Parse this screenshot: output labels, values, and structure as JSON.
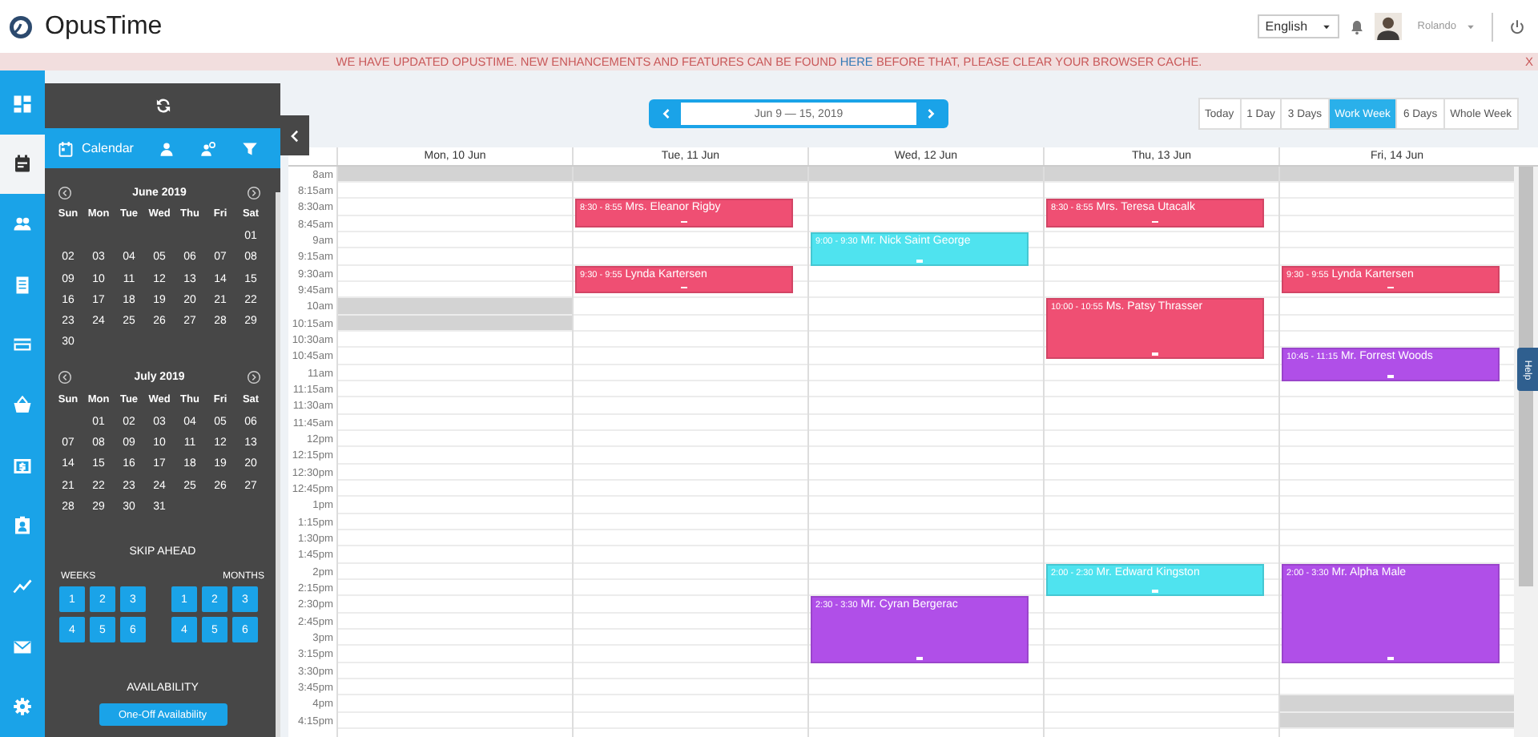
{
  "header": {
    "logo": "OpusTime",
    "language": "English",
    "user": "Rolando"
  },
  "banner": {
    "before": "WE HAVE UPDATED OPUSTIME. NEW ENHANCEMENTS AND FEATURES CAN BE FOUND",
    "link": "HERE",
    "after": "BEFORE THAT, PLEASE CLEAR YOUR BROWSER CACHE.",
    "close": "X"
  },
  "rail": [
    {
      "selected": false
    },
    {
      "selected": true
    },
    {
      "selected": false
    },
    {
      "selected": false
    },
    {
      "selected": false
    },
    {
      "selected": false
    },
    {
      "selected": false
    },
    {
      "selected": false
    },
    {
      "selected": false
    },
    {
      "selected": false
    },
    {
      "selected": false
    }
  ],
  "panel": {
    "tab": "Calendar",
    "months": [
      {
        "title": "June 2019",
        "weekdays": [
          "Sun",
          "Mon",
          "Tue",
          "Wed",
          "Thu",
          "Fri",
          "Sat"
        ],
        "weeks": [
          {
            "sat": "01"
          },
          {
            "sun": "02",
            "mon": "03",
            "tue": "04",
            "wed": "05",
            "thu": "06",
            "fri": "07",
            "sat": "08"
          },
          {
            "sun": "09",
            "mon": "10",
            "tue": "11",
            "wed": "12",
            "thu": "13",
            "fri": "14",
            "sat": "15"
          },
          {
            "sun": "16",
            "mon": "17",
            "tue": "18",
            "wed": "19",
            "thu": "20",
            "fri": "21",
            "sat": "22"
          },
          {
            "sun": "23",
            "mon": "24",
            "tue": "25",
            "wed": "26",
            "thu": "27",
            "fri": "28",
            "sat": "29"
          },
          {
            "sun": "30"
          }
        ]
      },
      {
        "title": "July 2019",
        "weekdays": [
          "Sun",
          "Mon",
          "Tue",
          "Wed",
          "Thu",
          "Fri",
          "Sat"
        ],
        "weeks": [
          {
            "mon": "01",
            "tue": "02",
            "wed": "03",
            "thu": "04",
            "fri": "05",
            "sat": "06"
          },
          {
            "sun": "07",
            "mon": "08",
            "tue": "09",
            "wed": "10",
            "thu": "11",
            "fri": "12",
            "sat": "13"
          },
          {
            "sun": "14",
            "mon": "15",
            "tue": "16",
            "wed": "17",
            "thu": "18",
            "fri": "19",
            "sat": "20"
          },
          {
            "sun": "21",
            "mon": "22",
            "tue": "23",
            "wed": "24",
            "thu": "25",
            "fri": "26",
            "sat": "27"
          },
          {
            "sun": "28",
            "mon": "29",
            "tue": "30",
            "wed": "31"
          }
        ]
      }
    ],
    "skip_ahead": {
      "title": "SKIP AHEAD",
      "weeks_label": "WEEKS",
      "months_label": "MONTHS",
      "weeks": [
        "1",
        "2",
        "3",
        "4",
        "5",
        "6"
      ],
      "months": [
        "1",
        "2",
        "3",
        "4",
        "5",
        "6"
      ]
    },
    "availability": {
      "title": "AVAILABILITY",
      "button": "One-Off Availability"
    }
  },
  "toolbar": {
    "range": "Jun 9 — 15, 2019",
    "views": [
      {
        "label": "Today",
        "selected": false
      },
      {
        "label": "1 Day",
        "selected": false
      },
      {
        "label": "3 Days",
        "selected": false
      },
      {
        "label": "Work Week",
        "selected": true
      },
      {
        "label": "6 Days",
        "selected": false
      },
      {
        "label": "Whole Week",
        "selected": false
      }
    ]
  },
  "calendar": {
    "rows": [
      {
        "time": "8am",
        "unavailable": [
          true,
          true,
          true,
          true,
          true
        ]
      },
      {
        "time": "8:15am",
        "unavailable": [
          false,
          false,
          false,
          false,
          false
        ]
      },
      {
        "time": "8:30am",
        "unavailable": [
          false,
          false,
          false,
          false,
          false
        ]
      },
      {
        "time": "8:45am",
        "unavailable": [
          false,
          false,
          false,
          false,
          false
        ]
      },
      {
        "time": "9am",
        "unavailable": [
          false,
          false,
          false,
          false,
          false
        ]
      },
      {
        "time": "9:15am",
        "unavailable": [
          false,
          false,
          false,
          false,
          false
        ]
      },
      {
        "time": "9:30am",
        "unavailable": [
          false,
          false,
          false,
          false,
          false
        ]
      },
      {
        "time": "9:45am",
        "unavailable": [
          false,
          false,
          false,
          false,
          false
        ]
      },
      {
        "time": "10am",
        "unavailable": [
          true,
          false,
          false,
          false,
          false
        ]
      },
      {
        "time": "10:15am",
        "unavailable": [
          true,
          false,
          false,
          false,
          false
        ]
      },
      {
        "time": "10:30am",
        "unavailable": [
          false,
          false,
          false,
          false,
          false
        ]
      },
      {
        "time": "10:45am",
        "unavailable": [
          false,
          false,
          false,
          false,
          false
        ]
      },
      {
        "time": "11am",
        "unavailable": [
          false,
          false,
          false,
          false,
          false
        ]
      },
      {
        "time": "11:15am",
        "unavailable": [
          false,
          false,
          false,
          false,
          false
        ]
      },
      {
        "time": "11:30am",
        "unavailable": [
          false,
          false,
          false,
          false,
          false
        ]
      },
      {
        "time": "11:45am",
        "unavailable": [
          false,
          false,
          false,
          false,
          false
        ]
      },
      {
        "time": "12pm",
        "unavailable": [
          false,
          false,
          false,
          false,
          false
        ]
      },
      {
        "time": "12:15pm",
        "unavailable": [
          false,
          false,
          false,
          false,
          false
        ]
      },
      {
        "time": "12:30pm",
        "unavailable": [
          false,
          false,
          false,
          false,
          false
        ]
      },
      {
        "time": "12:45pm",
        "unavailable": [
          false,
          false,
          false,
          false,
          false
        ]
      },
      {
        "time": "1pm",
        "unavailable": [
          false,
          false,
          false,
          false,
          false
        ]
      },
      {
        "time": "1:15pm",
        "unavailable": [
          false,
          false,
          false,
          false,
          false
        ]
      },
      {
        "time": "1:30pm",
        "unavailable": [
          false,
          false,
          false,
          false,
          false
        ]
      },
      {
        "time": "1:45pm",
        "unavailable": [
          false,
          false,
          false,
          false,
          false
        ]
      },
      {
        "time": "2pm",
        "unavailable": [
          false,
          false,
          false,
          false,
          false
        ]
      },
      {
        "time": "2:15pm",
        "unavailable": [
          false,
          false,
          false,
          false,
          false
        ]
      },
      {
        "time": "2:30pm",
        "unavailable": [
          false,
          false,
          false,
          false,
          false
        ]
      },
      {
        "time": "2:45pm",
        "unavailable": [
          false,
          false,
          false,
          false,
          false
        ]
      },
      {
        "time": "3pm",
        "unavailable": [
          false,
          false,
          false,
          false,
          false
        ]
      },
      {
        "time": "3:15pm",
        "unavailable": [
          false,
          false,
          false,
          false,
          false
        ]
      },
      {
        "time": "3:30pm",
        "unavailable": [
          false,
          false,
          false,
          false,
          false
        ]
      },
      {
        "time": "3:45pm",
        "unavailable": [
          false,
          false,
          false,
          false,
          false
        ]
      },
      {
        "time": "4pm",
        "unavailable": [
          false,
          false,
          false,
          false,
          true
        ]
      },
      {
        "time": "4:15pm",
        "unavailable": [
          false,
          false,
          false,
          false,
          true
        ]
      }
    ],
    "days": [
      {
        "label": "Mon, 10 Jun"
      },
      {
        "label": "Tue, 11 Jun",
        "events": [
          {
            "time": "8:30 - 8:55",
            "name": "Mrs. Eleanor Rigby",
            "color": "#ef4f73"
          },
          {
            "time": "9:30 - 9:55",
            "name": "Lynda Kartersen",
            "color": "#ef4f73"
          }
        ]
      },
      {
        "label": "Wed, 12 Jun",
        "events": [
          {
            "time": "9:00 - 9:30",
            "name": "Mr. Nick Saint George",
            "color": "#4fe3ef"
          },
          {
            "time": "2:30 - 3:30",
            "name": "Mr. Cyran Bergerac",
            "color": "#b04fe8"
          }
        ]
      },
      {
        "label": "Thu, 13 Jun",
        "events": [
          {
            "time": "8:30 - 8:55",
            "name": "Mrs. Teresa Utacalk",
            "color": "#ef4f73"
          },
          {
            "time": "10:00 - 10:55",
            "name": "Ms. Patsy Thrasser",
            "color": "#ef4f73"
          },
          {
            "time": "2:00 - 2:30",
            "name": "Mr. Edward Kingston",
            "color": "#4fe3ef"
          }
        ]
      },
      {
        "label": "Fri, 14 Jun",
        "events": [
          {
            "time": "9:30 - 9:55",
            "name": "Lynda Kartersen",
            "color": "#ef4f73"
          },
          {
            "time": "10:45 - 11:15",
            "name": "Mr. Forrest Woods",
            "color": "#b04fe8"
          },
          {
            "time": "2:00 - 3:30",
            "name": "Mr. Alpha Male",
            "color": "#b04fe8"
          }
        ]
      }
    ]
  },
  "help": "Help"
}
